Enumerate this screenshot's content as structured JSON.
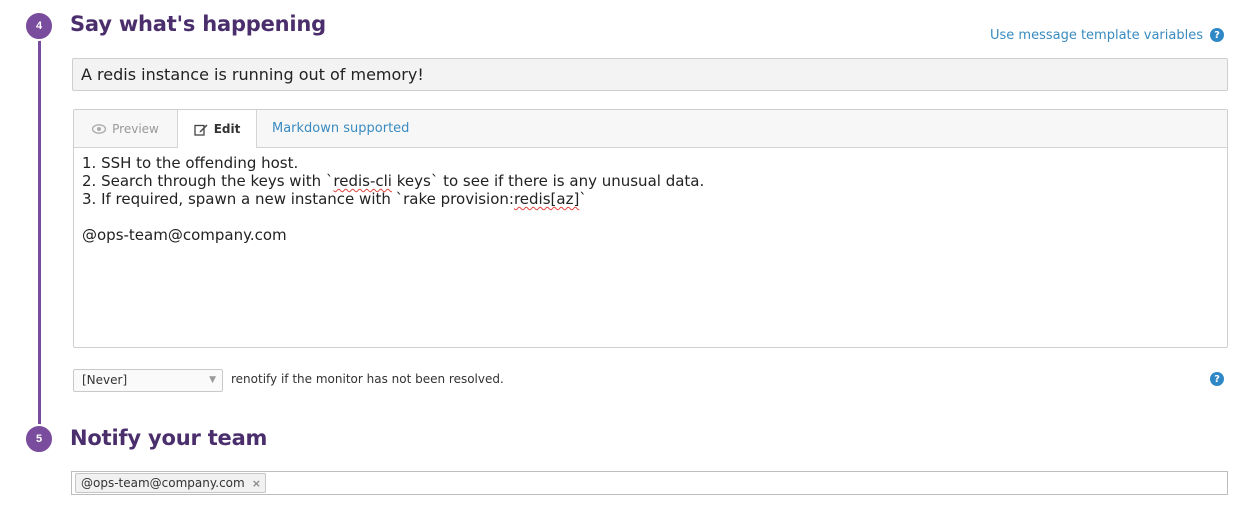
{
  "step4": {
    "number": "4",
    "heading": "Say what's happening",
    "template_link": "Use message template variables",
    "help": "?",
    "title_value": "A redis instance is running out of memory!",
    "editor": {
      "tab_preview": "Preview",
      "tab_edit": "Edit",
      "markdown_note": "Markdown supported",
      "lines": {
        "l1": "1. SSH to the offending host.",
        "l2_pre": "2. Search through the keys with `",
        "l2_spell": "redis-cli",
        "l2_post": " keys` to see if there is any unusual data.",
        "l3_pre": "3. If required, spawn a new instance with `rake provision:",
        "l3_spell": "redis[az]",
        "l3_post": "`",
        "l5": "@ops-team@company.com"
      }
    },
    "renotify": {
      "selected": "[Never]",
      "text": "renotify if the monitor has not been resolved."
    }
  },
  "step5": {
    "number": "5",
    "heading": "Notify your team",
    "recipients": [
      {
        "label": "@ops-team@company.com",
        "remove": "×"
      }
    ]
  },
  "colors": {
    "accent_purple": "#7a4c9e",
    "heading_purple": "#4b2e6c",
    "link_blue": "#3a8bc0",
    "help_blue": "#2f88c6"
  }
}
